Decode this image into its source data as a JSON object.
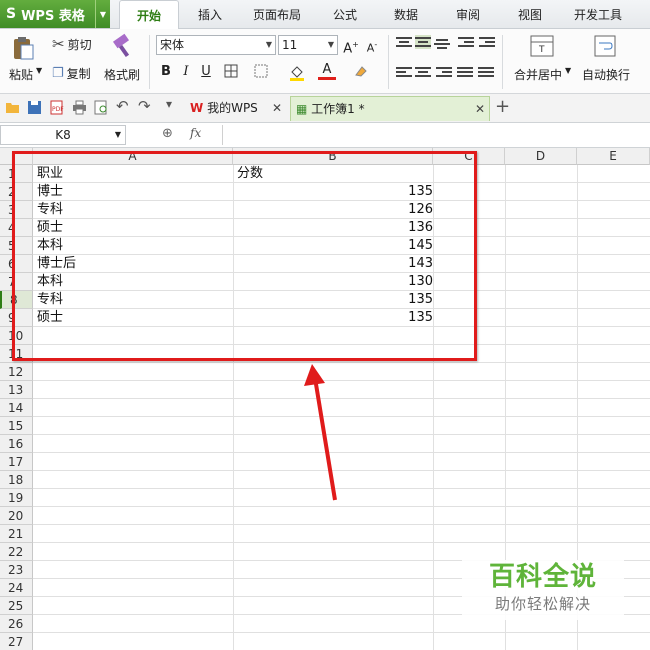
{
  "app": {
    "name": "WPS 表格"
  },
  "menu": {
    "tabs": [
      "开始",
      "插入",
      "页面布局",
      "公式",
      "数据",
      "审阅",
      "视图",
      "开发工具"
    ]
  },
  "ribbon": {
    "paste": "粘贴",
    "cut": "剪切",
    "copy": "复制",
    "format_painter": "格式刷",
    "font_name": "宋体",
    "font_size": "11",
    "merge_center": "合并居中",
    "wrap_text": "自动换行"
  },
  "doc_tabs": [
    {
      "label": "我的WPS"
    },
    {
      "label": "工作簿1 *"
    }
  ],
  "formula_bar": {
    "name_box": "K8",
    "fx": "fx"
  },
  "sheet": {
    "columns": [
      "A",
      "B",
      "C",
      "D",
      "E"
    ],
    "header_row": {
      "a": "职业",
      "b": "分数"
    },
    "rows": [
      {
        "a": "博士",
        "b": "135"
      },
      {
        "a": "专科",
        "b": "126"
      },
      {
        "a": "硕士",
        "b": "136"
      },
      {
        "a": "本科",
        "b": "145"
      },
      {
        "a": "博士后",
        "b": "143"
      },
      {
        "a": "本科",
        "b": "130"
      },
      {
        "a": "专科",
        "b": "135"
      },
      {
        "a": "硕士",
        "b": "135"
      }
    ],
    "row_numbers": [
      "1",
      "2",
      "3",
      "4",
      "5",
      "6",
      "7",
      "8",
      "9",
      "10",
      "11",
      "12",
      "13",
      "14",
      "15",
      "16",
      "17",
      "18",
      "19",
      "20",
      "21",
      "22",
      "23",
      "24",
      "25",
      "26",
      "27"
    ],
    "selected_row": "8"
  },
  "annotation": {
    "color": "#e01b1b"
  },
  "watermark": {
    "main": "百科全说",
    "sub": "助你轻松解决"
  }
}
